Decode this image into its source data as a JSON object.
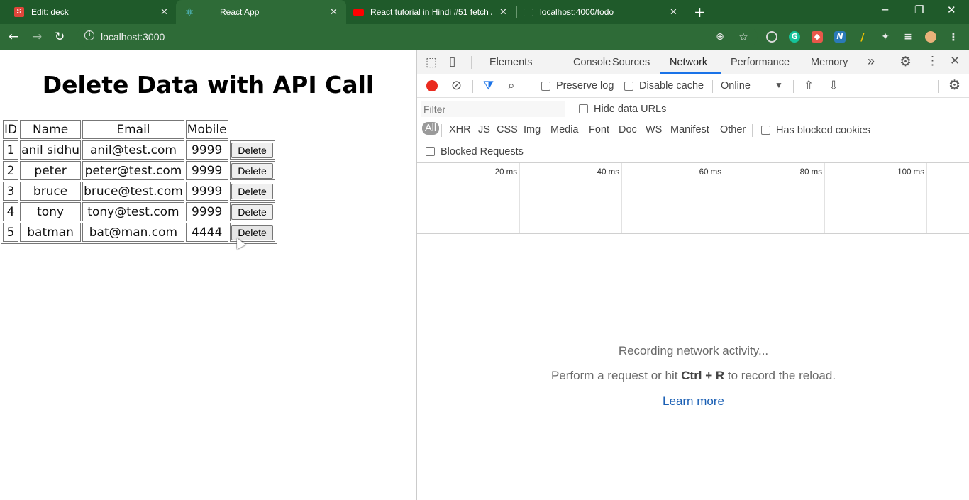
{
  "browser": {
    "tabs": [
      {
        "title": "Edit: deck",
        "icon": "slides-icon",
        "color": "#e0463a"
      },
      {
        "title": "React App",
        "icon": "react-icon",
        "color": "#61dafb"
      },
      {
        "title": "React tutorial in Hindi #51 fetch /",
        "icon": "youtube-icon",
        "color": "#ff0000"
      },
      {
        "title": "localhost:4000/todo",
        "icon": "page-icon",
        "color": "#cfcfcf"
      }
    ],
    "new_tab": "+",
    "url": "localhost:3000"
  },
  "page": {
    "heading": "Delete Data with API Call",
    "columns": [
      "ID",
      "Name",
      "Email",
      "Mobile"
    ],
    "rows": [
      {
        "id": "1",
        "name": "anil sidhu",
        "email": "anil@test.com",
        "mobile": "9999",
        "action": "Delete"
      },
      {
        "id": "2",
        "name": "peter",
        "email": "peter@test.com",
        "mobile": "9999",
        "action": "Delete"
      },
      {
        "id": "3",
        "name": "bruce",
        "email": "bruce@test.com",
        "mobile": "9999",
        "action": "Delete"
      },
      {
        "id": "4",
        "name": "tony",
        "email": "tony@test.com",
        "mobile": "9999",
        "action": "Delete"
      },
      {
        "id": "5",
        "name": "batman",
        "email": "bat@man.com",
        "mobile": "4444",
        "action": "Delete"
      }
    ]
  },
  "devtools": {
    "tabs": [
      "Elements",
      "Console",
      "Sources",
      "Network",
      "Performance",
      "Memory"
    ],
    "active_tab": "Network",
    "more": "»",
    "preserve_log": "Preserve log",
    "disable_cache": "Disable cache",
    "throttle": "Online",
    "filter_placeholder": "Filter",
    "hide_data_urls": "Hide data URLs",
    "types": [
      "All",
      "XHR",
      "JS",
      "CSS",
      "Img",
      "Media",
      "Font",
      "Doc",
      "WS",
      "Manifest",
      "Other"
    ],
    "has_blocked_cookies": "Has blocked cookies",
    "blocked_requests": "Blocked Requests",
    "ticks": [
      "20 ms",
      "40 ms",
      "60 ms",
      "80 ms",
      "100 ms"
    ],
    "empty": {
      "line1": "Recording network activity...",
      "line2_pre": "Perform a request or hit ",
      "line2_key": "Ctrl + R",
      "line2_post": " to record the reload.",
      "link": "Learn more"
    }
  }
}
